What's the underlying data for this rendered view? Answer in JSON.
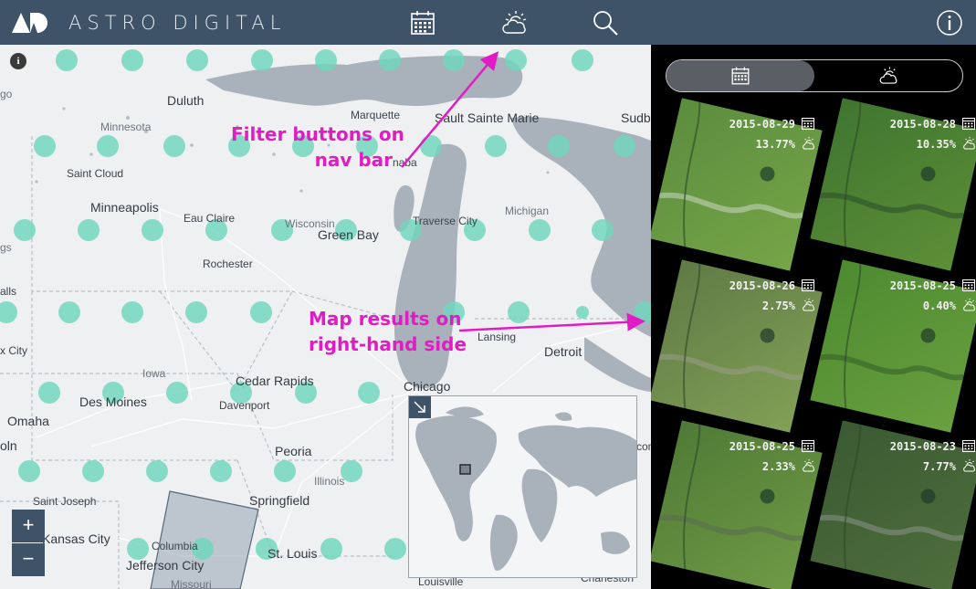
{
  "app": {
    "brand": "ASTRO DIGITAL"
  },
  "nav": {
    "calendar_icon": "calendar-icon",
    "weather_icon": "partly-cloudy-icon",
    "search_icon": "search-icon",
    "info_icon": "info-icon"
  },
  "map": {
    "info_badge": "i",
    "zoom_in": "+",
    "zoom_out": "−",
    "places": {
      "duluth": "Duluth",
      "marquette": "Marquette",
      "sault_sainte_marie": "Sault Sainte Marie",
      "sudbury": "Sudb",
      "minnesota": "Minnesota",
      "saint_cloud": "Saint Cloud",
      "escanaba": "naba",
      "minneapolis": "Minneapolis",
      "eau_claire": "Eau Claire",
      "wisconsin": "Wisconsin",
      "green_bay": "Green Bay",
      "traverse_city": "Traverse City",
      "michigan": "Michigan",
      "rochester": "Rochester",
      "falls": "alls",
      "go": "go",
      "gs": "gs",
      "lansing": "Lansing",
      "detroit": "Detroit",
      "sioux_city": "x City",
      "iowa": "Iowa",
      "cedar_rapids": "Cedar Rapids",
      "chicago": "Chicago",
      "des_moines": "Des Moines",
      "davenport": "Davenport",
      "omaha": "Omaha",
      "lincoln": "oln",
      "peoria": "Peoria",
      "illinois": "Illinois",
      "columbus": "Columb",
      "con": "con",
      "saint_joseph": "Saint Joseph",
      "springfield": "Springfield",
      "kansas_city": "Kansas City",
      "columbia": "Columbia",
      "st_louis": "St. Louis",
      "jefferson_city": "Jefferson City",
      "missouri": "Missouri",
      "louisville": "Louisville",
      "charleston": "Charleston"
    }
  },
  "annotations": {
    "filter_line1": "Filter buttons on",
    "filter_line2": "nav bar",
    "results_line1": "Map results on",
    "results_line2": "right-hand side"
  },
  "results": {
    "tabs": [
      "calendar-icon",
      "partly-cloudy-icon"
    ],
    "active_tab": 0,
    "scenes": [
      {
        "date": "2015-08-29",
        "cloud": "13.77%"
      },
      {
        "date": "2015-08-28",
        "cloud": "10.35%"
      },
      {
        "date": "2015-08-26",
        "cloud": "2.75%"
      },
      {
        "date": "2015-08-25",
        "cloud": "0.40%"
      },
      {
        "date": "2015-08-25",
        "cloud": "2.33%"
      },
      {
        "date": "2015-08-23",
        "cloud": "7.77%"
      }
    ]
  },
  "colors": {
    "navbar": "#3e5268",
    "footprint_dot": "#6fd6bd",
    "annotation": "#e21cc4",
    "water": "#a9b2ba",
    "land": "#eef0f2"
  }
}
